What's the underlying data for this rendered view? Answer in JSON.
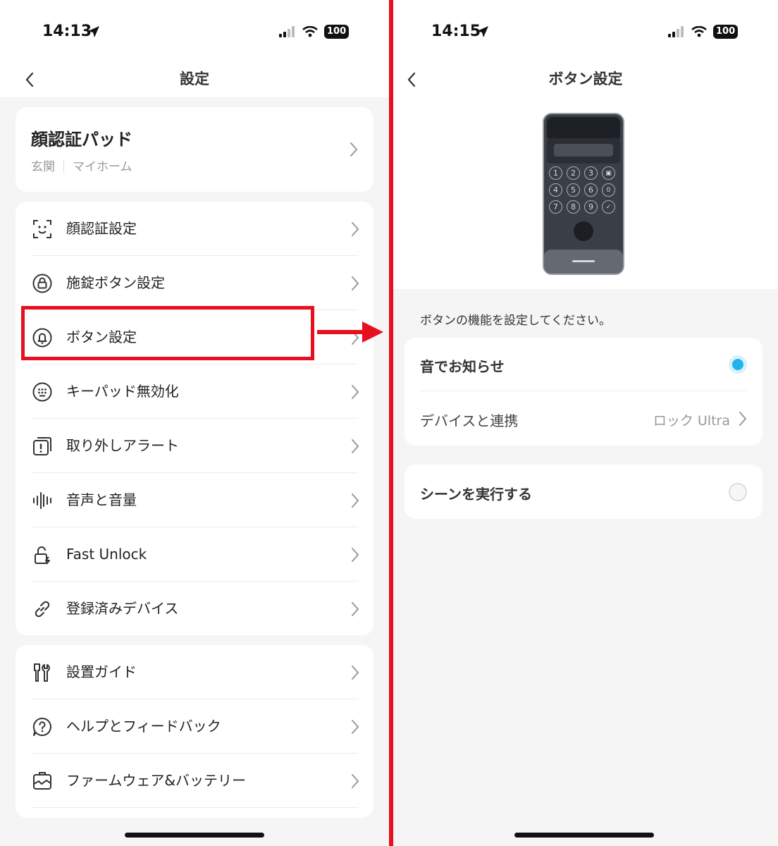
{
  "left": {
    "status": {
      "time": "14:13",
      "battery": "100"
    },
    "title": "設定",
    "device": {
      "name": "顔認証パッド",
      "location": "玄関",
      "home": "マイホーム"
    },
    "menu1": [
      {
        "label": "顔認証設定",
        "icon": "face-scan-icon"
      },
      {
        "label": "施錠ボタン設定",
        "icon": "lock-icon"
      },
      {
        "label": "ボタン設定",
        "icon": "bell-icon"
      },
      {
        "label": "キーパッド無効化",
        "icon": "keypad-icon"
      },
      {
        "label": "取り外しアラート",
        "icon": "alert-icon"
      },
      {
        "label": "音声と音量",
        "icon": "sound-wave-icon"
      },
      {
        "label": "Fast Unlock",
        "icon": "unlock-icon"
      },
      {
        "label": "登録済みデバイス",
        "icon": "link-icon"
      }
    ],
    "menu2": [
      {
        "label": "設置ガイド",
        "icon": "tools-icon"
      },
      {
        "label": "ヘルプとフィードバック",
        "icon": "help-icon"
      },
      {
        "label": "ファームウェア&バッテリー",
        "icon": "firmware-icon"
      }
    ]
  },
  "right": {
    "status": {
      "time": "14:15",
      "battery": "100"
    },
    "title": "ボタン設定",
    "keypad_keys": [
      "1",
      "2",
      "3",
      "4",
      "5",
      "6",
      "7",
      "8",
      "9"
    ],
    "hint": "ボタンの機能を設定してください。",
    "option_sound": {
      "label": "音でお知らせ",
      "selected": true
    },
    "option_link": {
      "label": "デバイスと連携",
      "value": "ロック Ultra"
    },
    "option_scene": {
      "label": "シーンを実行する",
      "selected": false
    }
  },
  "colors": {
    "highlight": "#e8101e",
    "radio_on": "#1fb4ea"
  }
}
